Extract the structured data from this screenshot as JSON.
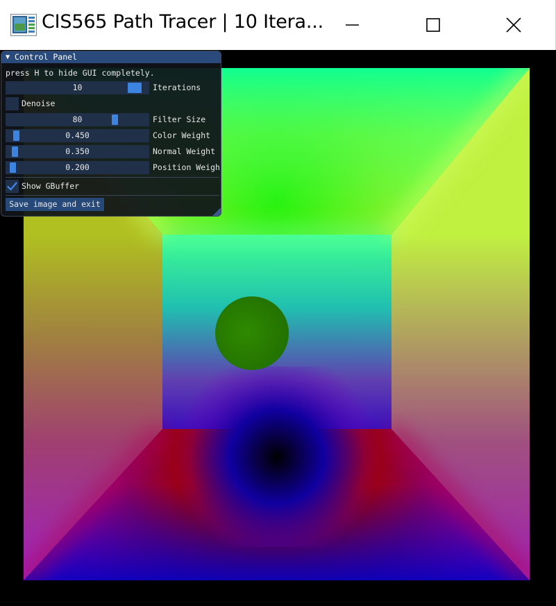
{
  "window": {
    "title": "CIS565 Path Tracer | 10 Itera..."
  },
  "control_panel": {
    "title": "Control Panel",
    "hint": "press H to hide GUI completely.",
    "iterations": {
      "value": "10",
      "label": "Iterations",
      "fraction": 0.95
    },
    "denoise": {
      "label": "Denoise",
      "checked": false
    },
    "filter_size": {
      "value": "80",
      "label": "Filter Size",
      "fraction": 0.78
    },
    "color_weight": {
      "value": "0.450",
      "label": "Color Weight",
      "fraction": 0.045
    },
    "normal_weight": {
      "value": "0.350",
      "label": "Normal Weight",
      "fraction": 0.035
    },
    "position_weight": {
      "value": "0.200",
      "label": "Position Weigh",
      "fraction": 0.02
    },
    "show_gbuffer": {
      "label": "Show GBuffer",
      "checked": true
    },
    "save_button": "Save image and exit"
  },
  "colors": {
    "titlebar_bg": "#ffffff",
    "panel_header": "#294a7a",
    "slider_bg": "#203049",
    "slider_grab": "#3d84e0",
    "checkmark": "#3d84e0"
  },
  "icons": {
    "app": "app-window-icon",
    "minimize": "minimize-icon",
    "maximize": "maximize-icon",
    "close": "close-icon",
    "collapse": "triangle-down-icon",
    "check": "checkmark-icon"
  }
}
